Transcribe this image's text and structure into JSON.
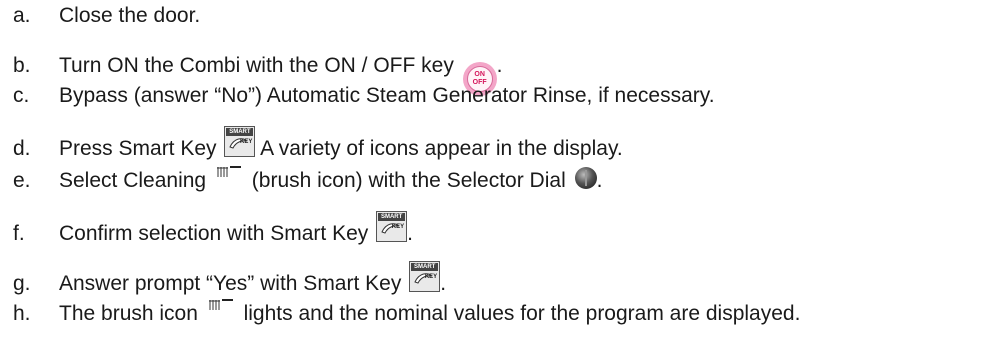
{
  "steps": [
    {
      "letter": "a.",
      "text": "Close the door."
    },
    {
      "letter": "b.",
      "text": "Turn ON the Combi with the ON / OFF key",
      "after": "."
    },
    {
      "letter": "c.",
      "text": "Bypass (answer “No”) Automatic Steam Generator Rinse, if necessary."
    },
    {
      "letter": "d.",
      "text": "Press Smart Key",
      "after": " A variety of icons appear in the display."
    },
    {
      "letter": "e.",
      "text": "Select Cleaning",
      "mid": " (brush icon) with the Selector Dial",
      "after": "."
    },
    {
      "letter": "f.",
      "text": "Confirm selection with Smart Key",
      "after": "."
    },
    {
      "letter": "g.",
      "text": "Answer prompt “Yes” with Smart Key",
      "after": "."
    },
    {
      "letter": "h.",
      "text": "The brush icon",
      "after": " lights and the nominal values for the program are displayed."
    }
  ],
  "icons": {
    "onoff": {
      "name": "on-off-key-icon",
      "top": "ON",
      "bottom": "OFF",
      "color": "#f3a6c8"
    },
    "smart": {
      "name": "smart-key-icon",
      "top": "SMART",
      "bottom": "KEY"
    },
    "brush": {
      "name": "brush-icon"
    },
    "dial": {
      "name": "selector-dial-icon"
    }
  }
}
